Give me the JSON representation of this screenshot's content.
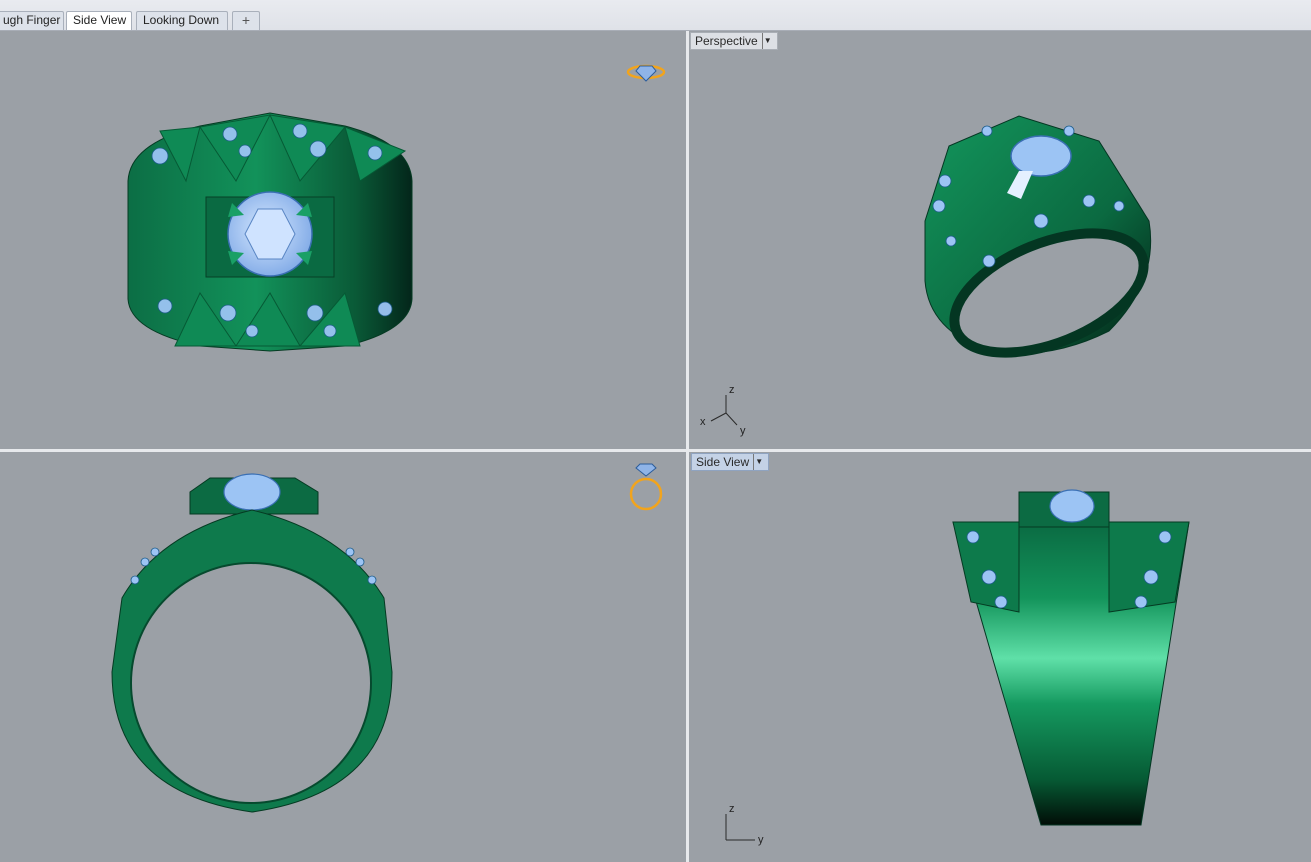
{
  "tabs": [
    {
      "label": "ugh Finger"
    },
    {
      "label": "Side View"
    },
    {
      "label": "Looking Down"
    },
    {
      "label": "+"
    }
  ],
  "viewports": {
    "top_right": {
      "label": "Perspective"
    },
    "bottom_right": {
      "label": "Side View"
    }
  },
  "axes": {
    "perspective": {
      "x": "x",
      "y": "y",
      "z": "z"
    },
    "side": {
      "y": "y",
      "z": "z"
    }
  },
  "colors": {
    "viewport_bg": "#9ba0a6",
    "ring_green": "#0e7a4c",
    "ring_dark": "#06301c",
    "gem_blue": "#9cc4f4",
    "nav_icon": "#f2a41c"
  }
}
